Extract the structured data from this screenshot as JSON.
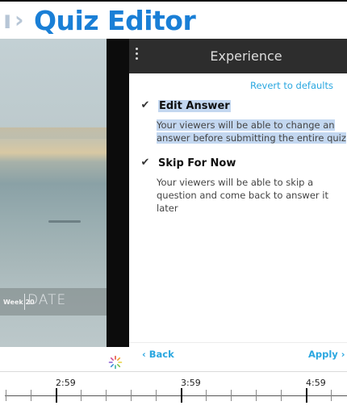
{
  "header": {
    "breadcrumb_tail": "ı",
    "breadcrumb_separator": "›",
    "title": "Quiz Editor"
  },
  "video": {
    "caption_small": "Week 20",
    "caption_big": "DATE"
  },
  "panel": {
    "title": "Experience",
    "revert_label": "Revert to defaults",
    "options": [
      {
        "title": "Edit Answer",
        "checked": true,
        "description": "Your viewers will be able to change an answer before submitting the entire quiz"
      },
      {
        "title": "Skip For Now",
        "checked": true,
        "description": "Your viewers will be able to skip a question and come back to answer it later"
      }
    ],
    "check_glyph": "✔",
    "back_label": "‹ Back",
    "apply_label": "Apply ›"
  },
  "timeline": {
    "labels": [
      "2:59",
      "3:59",
      "4:59"
    ]
  },
  "colors": {
    "title_blue": "#1a7fd6",
    "link_blue": "#2aa7e0",
    "panel_header": "#2d2d2d",
    "highlight": "#c3d7f0"
  }
}
